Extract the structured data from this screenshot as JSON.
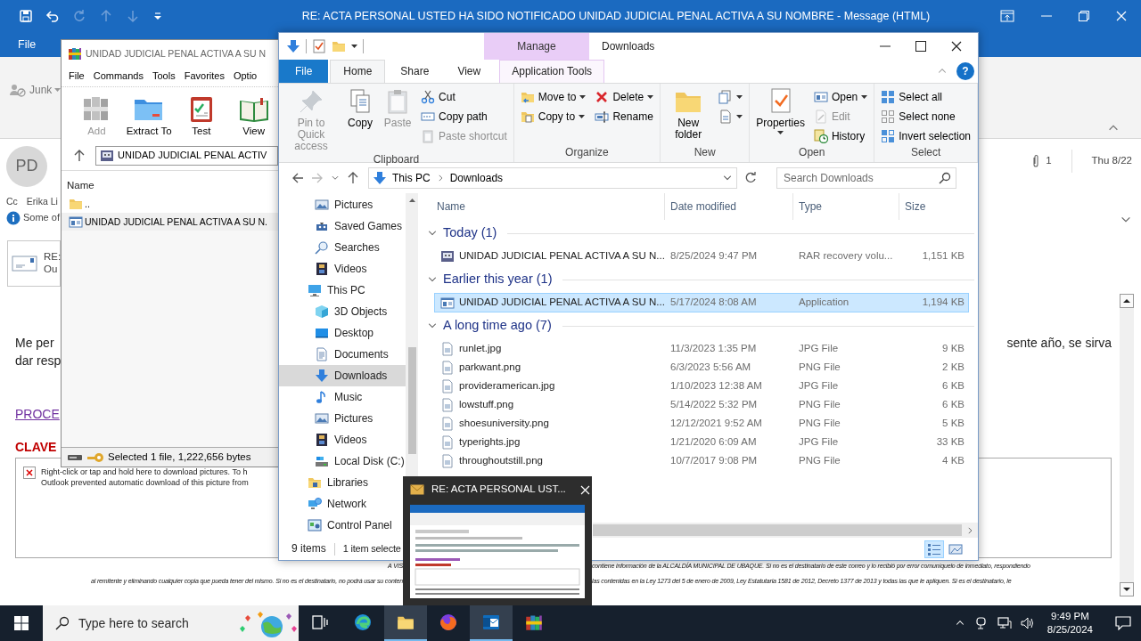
{
  "outlook": {
    "title": "RE: ACTA PERSONAL USTED HA SIDO NOTIFICADO UNIDAD JUDICIAL PENAL ACTIVA A SU NOMBRE  -  Message (HTML)",
    "file_tab": "File",
    "junk_button": "Junk",
    "header": {
      "avatar": "PD",
      "cc_label": "Cc",
      "cc_name": "Erika Li",
      "info": "Some of",
      "attachment_count": "1",
      "date": "Thu 8/22"
    },
    "attachment": {
      "title": "RE:",
      "subtitle": "Ou"
    },
    "body": {
      "line_1": "Me per",
      "line_1_end": "sente año, se sirva",
      "line_2": "dar resp",
      "link": "PROCE",
      "heading": "CLAVE",
      "blocked_picture": [
        "Right-click or tap and hold here to download pictures. To h",
        "Outlook prevented automatic download of this picture from"
      ],
      "disclaimer": [
        {
          "left": "A VIS",
          "right": "contiene información de la ALCALDÍA MUNICIPAL DE UBAQUE. Si no es el destinatario de este correo y lo recibió por error comuníquelo de inmediato, respondiendo"
        },
        {
          "left": "al remitente y eliminando cualquier copia que pueda tener del mismo. Si no es el destinatario, no podrá usar su conten",
          "right": "las contenidas en la Ley 1273 del 5 de enero de 2009, Ley Estatutaria 1581 de 2012, Decreto 1377 de 2013 y todas las que le apliquen. Si es el destinatario, le"
        }
      ]
    }
  },
  "winrar": {
    "title": "UNIDAD JUDICIAL PENAL ACTIVA A SU N",
    "menu": [
      "File",
      "Commands",
      "Tools",
      "Favorites",
      "Optio"
    ],
    "toolbar": [
      {
        "label": "Add",
        "disabled": true
      },
      {
        "label": "Extract To",
        "disabled": false
      },
      {
        "label": "Test",
        "disabled": false
      },
      {
        "label": "View",
        "disabled": false
      }
    ],
    "path": "UNIDAD JUDICIAL PENAL ACTIV",
    "column": "Name",
    "files": [
      {
        "name": "..",
        "selected": false
      },
      {
        "name": "UNIDAD JUDICIAL PENAL ACTIVA A SU N.",
        "selected": true
      }
    ],
    "status": "Selected 1 file, 1,222,656 bytes"
  },
  "explorer": {
    "title": "Downloads",
    "context_tab": "Manage",
    "help": "?",
    "tabs": [
      {
        "label": "File",
        "kind": "file",
        "selected": false
      },
      {
        "label": "Home",
        "kind": "tab",
        "selected": true
      },
      {
        "label": "Share",
        "kind": "tab",
        "selected": false
      },
      {
        "label": "View",
        "kind": "tab",
        "selected": false
      },
      {
        "label": "Application Tools",
        "kind": "context",
        "selected": false
      }
    ],
    "ribbon_groups": [
      {
        "label": "Clipboard",
        "buttons": [
          {
            "label": "Pin to Quick access",
            "kind": "large",
            "disabled": true
          },
          {
            "label": "Copy",
            "kind": "large",
            "disabled": false
          },
          {
            "label": "Paste",
            "kind": "large",
            "disabled": true
          },
          {
            "label": "Cut",
            "kind": "small",
            "disabled": false
          },
          {
            "label": "Copy path",
            "kind": "small",
            "disabled": false
          },
          {
            "label": "Paste shortcut",
            "kind": "small",
            "disabled": true
          }
        ]
      },
      {
        "label": "Organize",
        "buttons": [
          {
            "label": "Move to",
            "kind": "small",
            "disabled": false,
            "dropdown": true
          },
          {
            "label": "Copy to",
            "kind": "small",
            "disabled": false,
            "dropdown": true
          },
          {
            "label": "Delete",
            "kind": "small",
            "disabled": false,
            "dropdown": true
          },
          {
            "label": "Rename",
            "kind": "small",
            "disabled": false
          }
        ]
      },
      {
        "label": "New",
        "buttons": [
          {
            "label": "New folder",
            "kind": "large",
            "disabled": false
          },
          {
            "kind": "small",
            "disabled": false,
            "dropdown": true
          },
          {
            "kind": "small",
            "disabled": false,
            "dropdown": true
          }
        ]
      },
      {
        "label": "Open",
        "buttons": [
          {
            "label": "Properties",
            "kind": "large",
            "disabled": false,
            "dropdown": true
          },
          {
            "label": "Open",
            "kind": "small",
            "disabled": false,
            "dropdown": true
          },
          {
            "label": "Edit",
            "kind": "small",
            "disabled": true
          },
          {
            "label": "History",
            "kind": "small",
            "disabled": false
          }
        ]
      },
      {
        "label": "Select",
        "buttons": [
          {
            "label": "Select all",
            "kind": "small",
            "disabled": false
          },
          {
            "label": "Select none",
            "kind": "small",
            "disabled": false
          },
          {
            "label": "Invert selection",
            "kind": "small",
            "disabled": false
          }
        ]
      }
    ],
    "address": {
      "path": [
        "This PC",
        "Downloads"
      ],
      "search_placeholder": "Search Downloads"
    },
    "nav_pane": {
      "scrolled_items": [
        {
          "label": "Pictures",
          "selected": false
        },
        {
          "label": "Saved Games",
          "selected": false
        },
        {
          "label": "Searches",
          "selected": false
        },
        {
          "label": "Videos",
          "selected": false
        }
      ],
      "items": [
        {
          "label": "This PC",
          "selected": false,
          "children": [
            {
              "label": "3D Objects",
              "selected": false
            },
            {
              "label": "Desktop",
              "selected": false
            },
            {
              "label": "Documents",
              "selected": false
            },
            {
              "label": "Downloads",
              "selected": true
            },
            {
              "label": "Music",
              "selected": false
            },
            {
              "label": "Pictures",
              "selected": false
            },
            {
              "label": "Videos",
              "selected": false
            },
            {
              "label": "Local Disk (C:)",
              "selected": false
            }
          ]
        },
        {
          "label": "Libraries",
          "selected": false
        },
        {
          "label": "Network",
          "selected": false
        },
        {
          "label": "Control Panel",
          "selected": false
        }
      ]
    },
    "columns": [
      "Name",
      "Date modified",
      "Type",
      "Size"
    ],
    "groups": [
      {
        "label": "Today (1)",
        "expanded": true,
        "files": [
          {
            "name": "UNIDAD JUDICIAL PENAL ACTIVA A SU N...",
            "date": "8/25/2024 9:47 PM",
            "type": "RAR recovery volu...",
            "size": "1,151 KB",
            "selected": false
          }
        ]
      },
      {
        "label": "Earlier this year (1)",
        "expanded": true,
        "files": [
          {
            "name": "UNIDAD JUDICIAL PENAL ACTIVA A SU N...",
            "date": "5/17/2024 8:08 AM",
            "type": "Application",
            "size": "1,194 KB",
            "selected": true
          }
        ]
      },
      {
        "label": "A long time ago (7)",
        "expanded": true,
        "files": [
          {
            "name": "runlet.jpg",
            "date": "11/3/2023 1:35 PM",
            "type": "JPG File",
            "size": "9 KB",
            "selected": false
          },
          {
            "name": "parkwant.png",
            "date": "6/3/2023 5:56 AM",
            "type": "PNG File",
            "size": "2 KB",
            "selected": false
          },
          {
            "name": "provideramerican.jpg",
            "date": "1/10/2023 12:38 AM",
            "type": "JPG File",
            "size": "6 KB",
            "selected": false
          },
          {
            "name": "lowstuff.png",
            "date": "5/14/2022 5:32 PM",
            "type": "PNG File",
            "size": "6 KB",
            "selected": false
          },
          {
            "name": "shoesuniversity.png",
            "date": "12/12/2021 9:52 AM",
            "type": "PNG File",
            "size": "5 KB",
            "selected": false
          },
          {
            "name": "typerights.jpg",
            "date": "1/21/2020 6:09 AM",
            "type": "JPG File",
            "size": "33 KB",
            "selected": false
          },
          {
            "name": "throughoutstill.png",
            "date": "10/7/2017 9:08 PM",
            "type": "PNG File",
            "size": "4 KB",
            "selected": false
          }
        ]
      }
    ],
    "status": {
      "count": "9 items",
      "selection": "1 item selecte"
    },
    "views": [
      {
        "kind": "details",
        "selected": true
      },
      {
        "kind": "large",
        "selected": false
      }
    ]
  },
  "preview": {
    "title": "RE: ACTA PERSONAL UST..."
  },
  "taskbar": {
    "search_placeholder": "Type here to search",
    "apps": [
      {
        "kind": "task-view",
        "active": false
      },
      {
        "kind": "edge",
        "active": false
      },
      {
        "kind": "explorer",
        "active": true
      },
      {
        "kind": "firefox",
        "active": false
      },
      {
        "kind": "outlook",
        "active": true
      },
      {
        "kind": "winrar",
        "active": false
      }
    ],
    "time": "9:49 PM",
    "date": "8/25/2024"
  }
}
